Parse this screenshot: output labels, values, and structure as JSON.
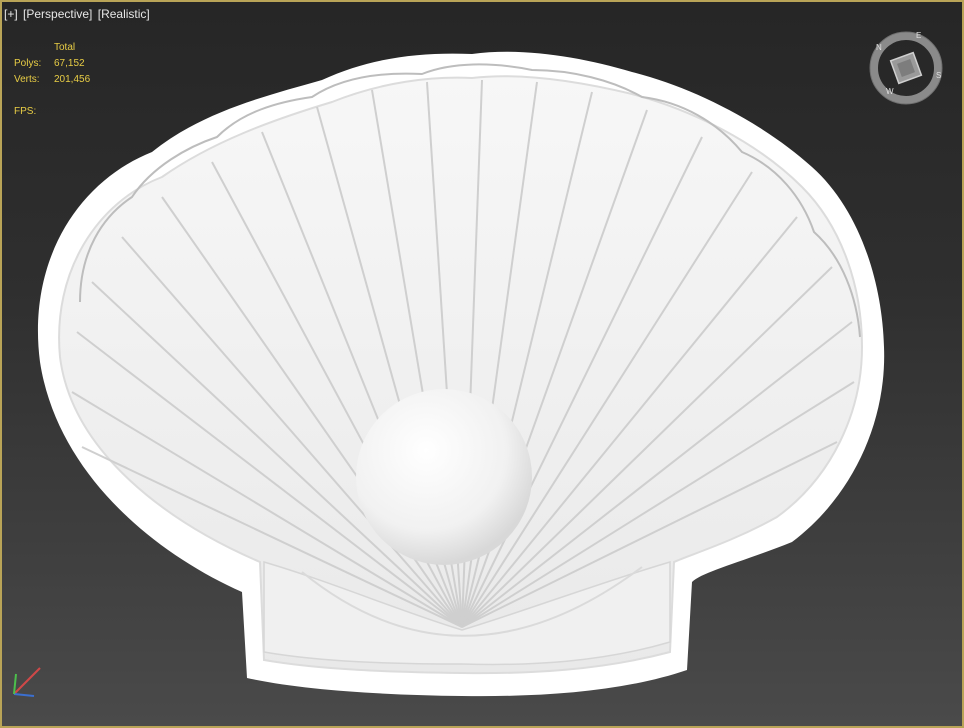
{
  "viewport": {
    "labels": [
      "[+]",
      "[Perspective]",
      "[Realistic]"
    ],
    "stats": {
      "header": "Total",
      "polys_label": "Polys:",
      "polys_value": "67,152",
      "verts_label": "Verts:",
      "verts_value": "201,456",
      "fps_label": "FPS:"
    },
    "viewcube_letters": [
      "N",
      "E",
      "S",
      "W"
    ],
    "colors": {
      "border": "#b9a457",
      "stats_text": "#e8cd45",
      "shell": "#f4f4f4"
    }
  }
}
